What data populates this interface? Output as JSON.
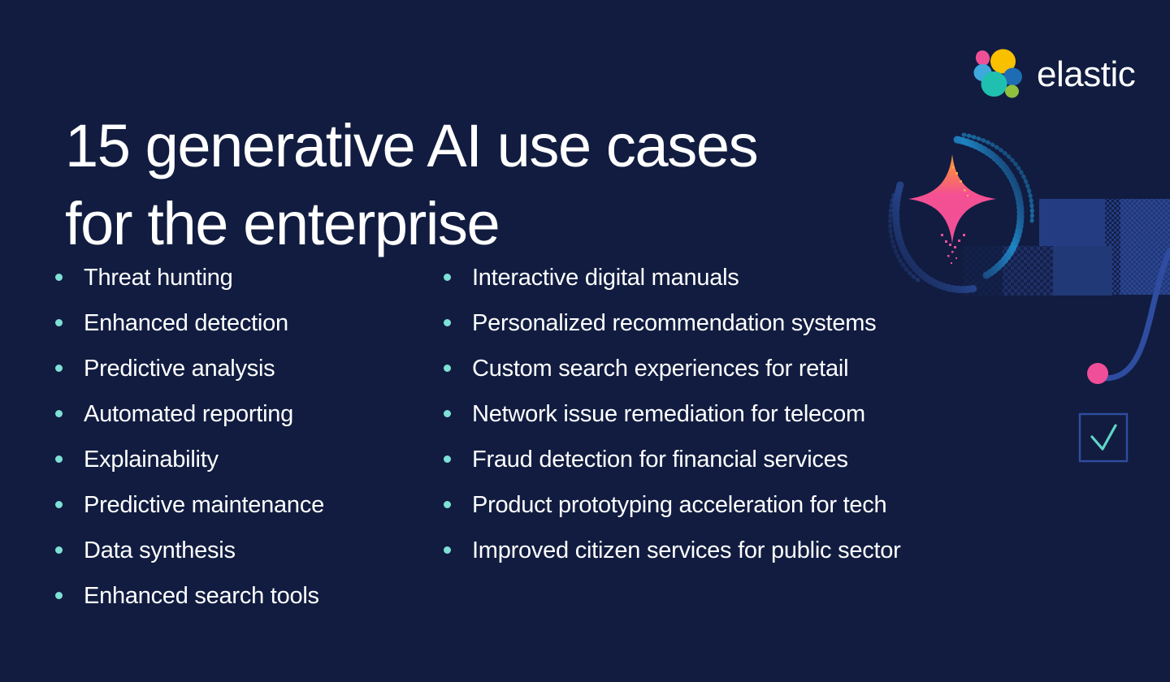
{
  "brand": {
    "name": "elastic",
    "logo_icon": "elastic-logo-icon",
    "colors": {
      "background": "#111c40",
      "text": "#ffffff",
      "bullet": "#7ee0d6",
      "accent_pink": "#f04e98",
      "accent_blue": "#2a3f86",
      "accent_teal": "#5fd6c8",
      "logo_yellow": "#f9c000",
      "logo_pink": "#ee5097",
      "logo_teal": "#20c0b0",
      "logo_blue_light": "#3fa8dd",
      "logo_blue_dark": "#1e6cb4",
      "logo_green": "#8fc13f"
    }
  },
  "headline": {
    "line1": "15 generative AI use cases",
    "line2": "for the enterprise",
    "full": "15 generative AI use cases\nfor the enterprise"
  },
  "lists": {
    "left_column": [
      {
        "label": "Threat hunting"
      },
      {
        "label": "Enhanced detection"
      },
      {
        "label": "Predictive analysis"
      },
      {
        "label": "Automated reporting"
      },
      {
        "label": "Explainability"
      },
      {
        "label": "Predictive maintenance"
      },
      {
        "label": "Data synthesis"
      },
      {
        "label": "Enhanced search tools"
      }
    ],
    "right_column": [
      {
        "label": "Interactive digital manuals"
      },
      {
        "label": "Personalized recommendation systems"
      },
      {
        "label": "Custom search experiences for retail"
      },
      {
        "label": "Network issue remediation for telecom"
      },
      {
        "label": "Fraud detection for financial services"
      },
      {
        "label": "Product prototyping acceleration for tech"
      },
      {
        "label": "Improved citizen services for public sector"
      }
    ]
  },
  "decorations": {
    "sparkle_icon": "four-point-star-icon",
    "checkbox_icon": "checkbox-checkmark-icon",
    "dot_icon": "pink-dot-icon",
    "curve_icon": "blue-curve-icon",
    "rectangles": "blue-dithered-rectangles"
  }
}
